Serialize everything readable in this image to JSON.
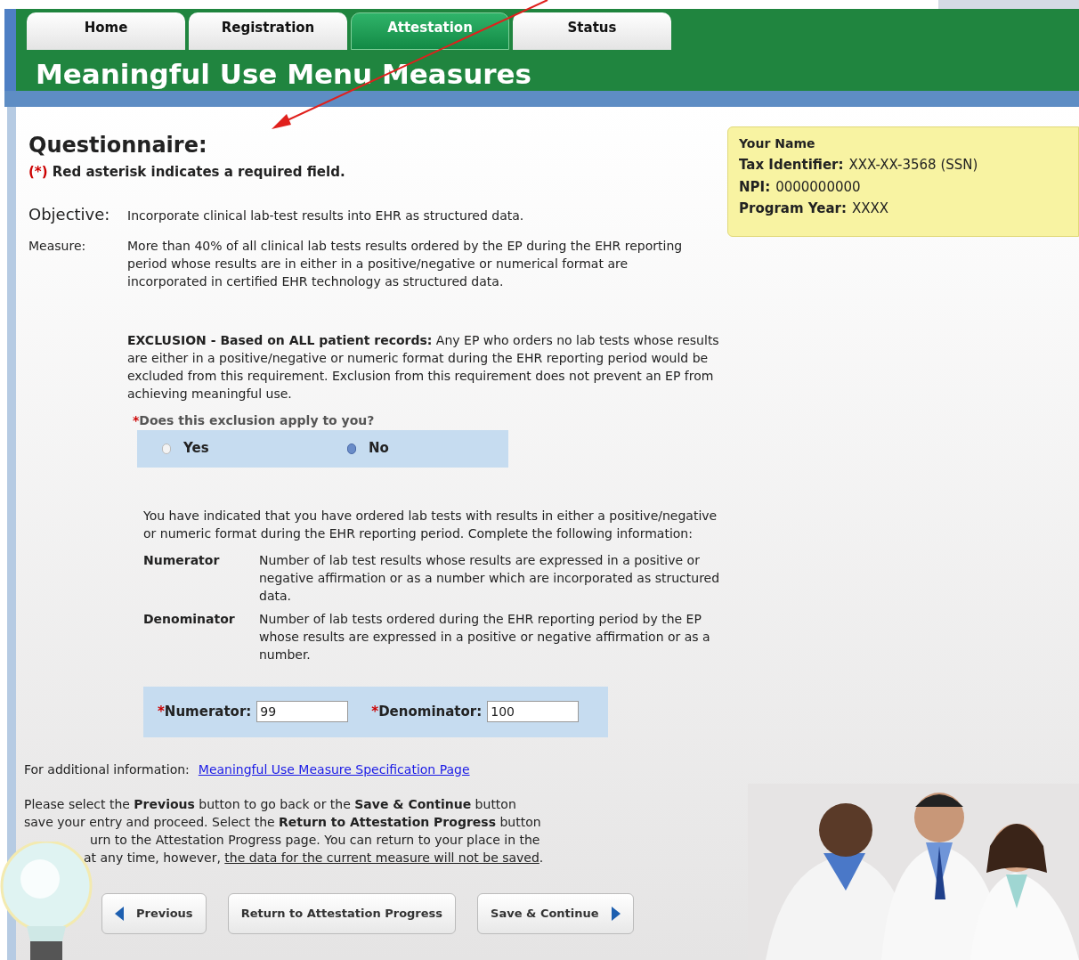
{
  "tabs": [
    {
      "label": "Home",
      "selected": false
    },
    {
      "label": "Registration",
      "selected": false
    },
    {
      "label": "Attestation",
      "selected": true
    },
    {
      "label": "Status",
      "selected": false
    }
  ],
  "page_title": "Meaningful Use Menu Measures",
  "questionnaire": {
    "title": "Questionnaire:",
    "marker": "(*)",
    "note": "Red asterisk indicates a required field."
  },
  "provider": {
    "name": "Your Name",
    "fields": [
      {
        "label": "Tax Identifier:",
        "value": "XXX-XX-3568 (SSN)"
      },
      {
        "label": "NPI:",
        "value": "0000000000"
      },
      {
        "label": "Program Year:",
        "value": "XXXX"
      }
    ]
  },
  "objective": {
    "label": "Objective:",
    "text": "Incorporate clinical lab-test results into EHR as structured data."
  },
  "measure": {
    "label": "Measure:",
    "text": "More than 40% of all clinical lab tests results ordered by the EP during the EHR reporting period whose results are in either in a positive/negative or numerical format are incorporated in certified EHR technology as structured data."
  },
  "exclusion": "**EXCLUSION - Based on ALL patient records:** Any EP who orders no lab tests whose results are either in a positive/negative or numeric format during the EHR reporting period would be excluded from this requirement. Exclusion from this requirement does not prevent an EP from achieving meaningful use.",
  "question": {
    "asterisk": "*",
    "text": "Does this exclusion apply to you?",
    "options": [
      {
        "label": "Yes",
        "selected": false
      },
      {
        "label": "No",
        "selected": true
      }
    ]
  },
  "info_text": "You have indicated that you have ordered lab tests with results in either a positive/negative or numeric format during the EHR reporting period. Complete the following information:",
  "definitions": [
    {
      "term": "Numerator",
      "text": "Number of lab test results whose results are expressed in a positive or negative affirmation or as a number which are incorporated as structured data."
    },
    {
      "term": "Denominator",
      "text": "Number of lab tests ordered during the EHR reporting period by the EP whose results are expressed in a positive or negative affirmation or as a number."
    }
  ],
  "inputs": [
    {
      "asterisk": "*",
      "label": "Numerator:",
      "value": "99"
    },
    {
      "asterisk": "*",
      "label": "Denominator:",
      "value": "100"
    }
  ],
  "additional_info": {
    "label": "For additional information:",
    "link": "Meaningful Use Measure Specification Page"
  },
  "instructions": {
    "lines": [
      "Please select the **Previous** button to go back or the **Save & Continue** button",
      "save your entry and proceed. Select the **Return to Attestation Progress** button",
      "urn to the Attestation Progress page. You can return to your place in the"
    ],
    "last_line": {
      "text": "at any time, however, ",
      "underlined": "the data for the current measure will not be saved",
      "end": "."
    }
  },
  "buttons": [
    {
      "label": "Previous",
      "kind": "back"
    },
    {
      "label": "Return to Attestation Progress",
      "kind": "plain"
    },
    {
      "label": "Save & Continue",
      "kind": "forward"
    }
  ]
}
